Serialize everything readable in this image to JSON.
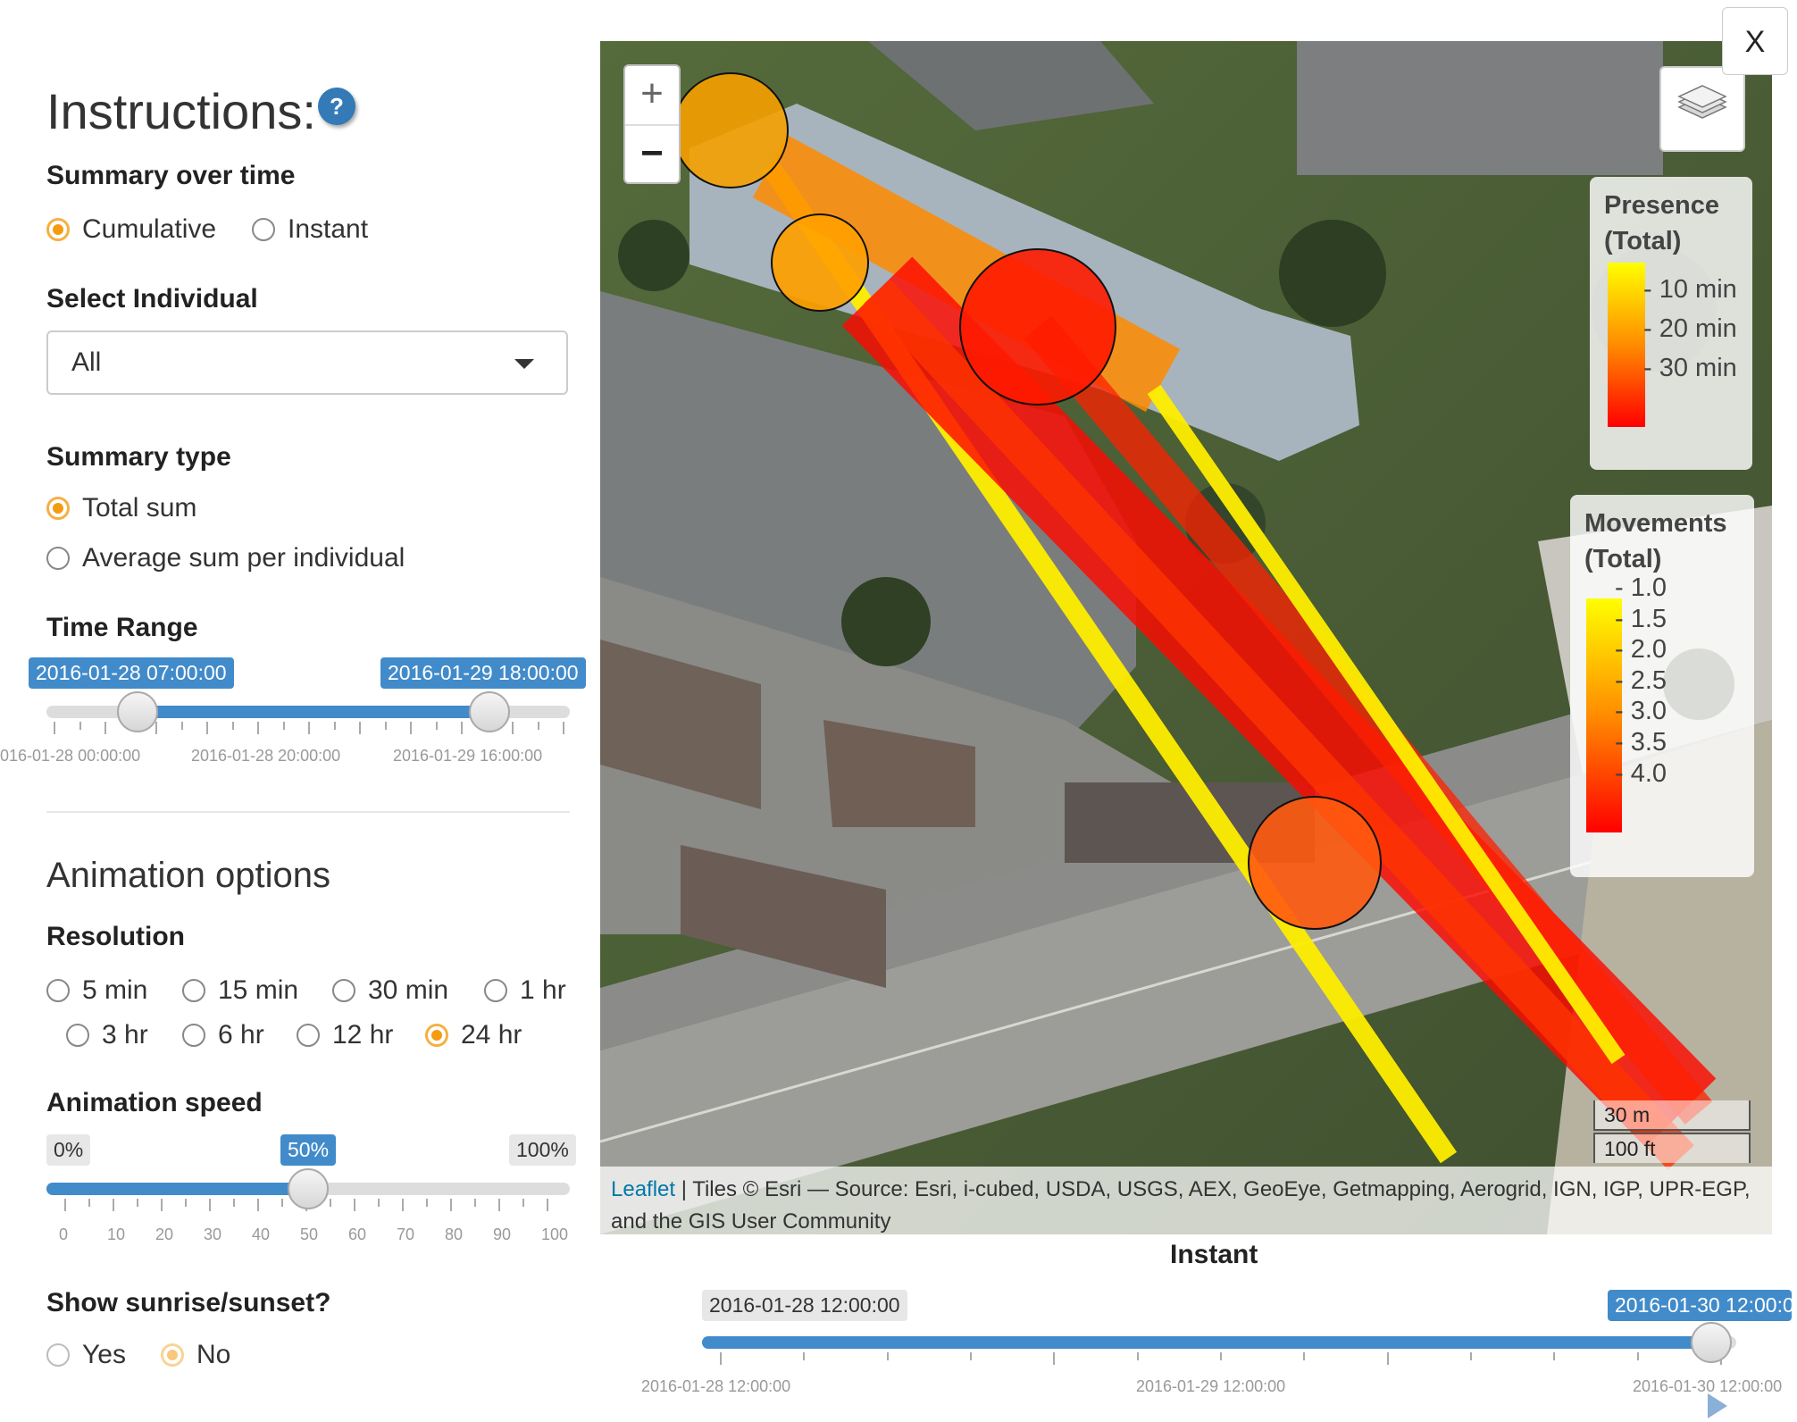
{
  "sidebar": {
    "title": "Instructions:",
    "help_label": "?",
    "summary_over_time": {
      "label": "Summary over time",
      "options": [
        "Cumulative",
        "Instant"
      ],
      "selected": "Cumulative"
    },
    "select_individual": {
      "label": "Select Individual",
      "value": "All"
    },
    "summary_type": {
      "label": "Summary type",
      "options": [
        "Total sum",
        "Average sum per individual"
      ],
      "selected": "Total sum"
    },
    "time_range": {
      "label": "Time Range",
      "from": "2016-01-28 07:00:00",
      "to": "2016-01-29 18:00:00",
      "tick_labels": [
        "016-01-28 00:00:00",
        "2016-01-28 20:00:00",
        "2016-01-29 16:00:00"
      ]
    },
    "animation": {
      "title": "Animation options",
      "resolution": {
        "label": "Resolution",
        "options": [
          "5 min",
          "15 min",
          "30 min",
          "1 hr",
          "3 hr",
          "6 hr",
          "12 hr",
          "24 hr"
        ],
        "selected": "24 hr"
      },
      "speed": {
        "label": "Animation speed",
        "min_label": "0%",
        "max_label": "100%",
        "value_label": "50%",
        "value": 50,
        "ticks": [
          "0",
          "10",
          "20",
          "30",
          "40",
          "50",
          "60",
          "70",
          "80",
          "90",
          "100"
        ]
      },
      "sunrise": {
        "label": "Show sunrise/sunset?",
        "options": [
          "Yes",
          "No"
        ],
        "selected": "No"
      }
    }
  },
  "map": {
    "zoom_in": "+",
    "zoom_out": "−",
    "close_label": "X",
    "legend_presence": {
      "title_line1": "Presence",
      "title_line2": "(Total)",
      "labels": [
        "10 min",
        "20 min",
        "30 min"
      ],
      "gradient": [
        "#ffff00",
        "#ff8c00",
        "#ff0000"
      ]
    },
    "legend_movements": {
      "title_line1": "Movements",
      "title_line2": "(Total)",
      "labels": [
        "1.0",
        "1.5",
        "2.0",
        "2.5",
        "3.0",
        "3.5",
        "4.0"
      ],
      "gradient": [
        "#ffff00",
        "#ff8c00",
        "#ff0000"
      ]
    },
    "scale": {
      "metric": "30 m",
      "imperial": "100 ft"
    },
    "attribution": {
      "link": "Leaflet",
      "text": " | Tiles © Esri — Source: Esri, i-cubed, USDA, USGS, AEX, GeoEye, Getmapping, Aerogrid, IGN, IGP, UPR-EGP, and the GIS User Community"
    }
  },
  "instant": {
    "title": "Instant",
    "from": "2016-01-28 12:00:00",
    "to": "2016-01-30 12:00:0",
    "tick_labels": [
      "2016-01-28 12:00:00",
      "2016-01-29 12:00:00",
      "2016-01-30 12:00:00"
    ]
  }
}
